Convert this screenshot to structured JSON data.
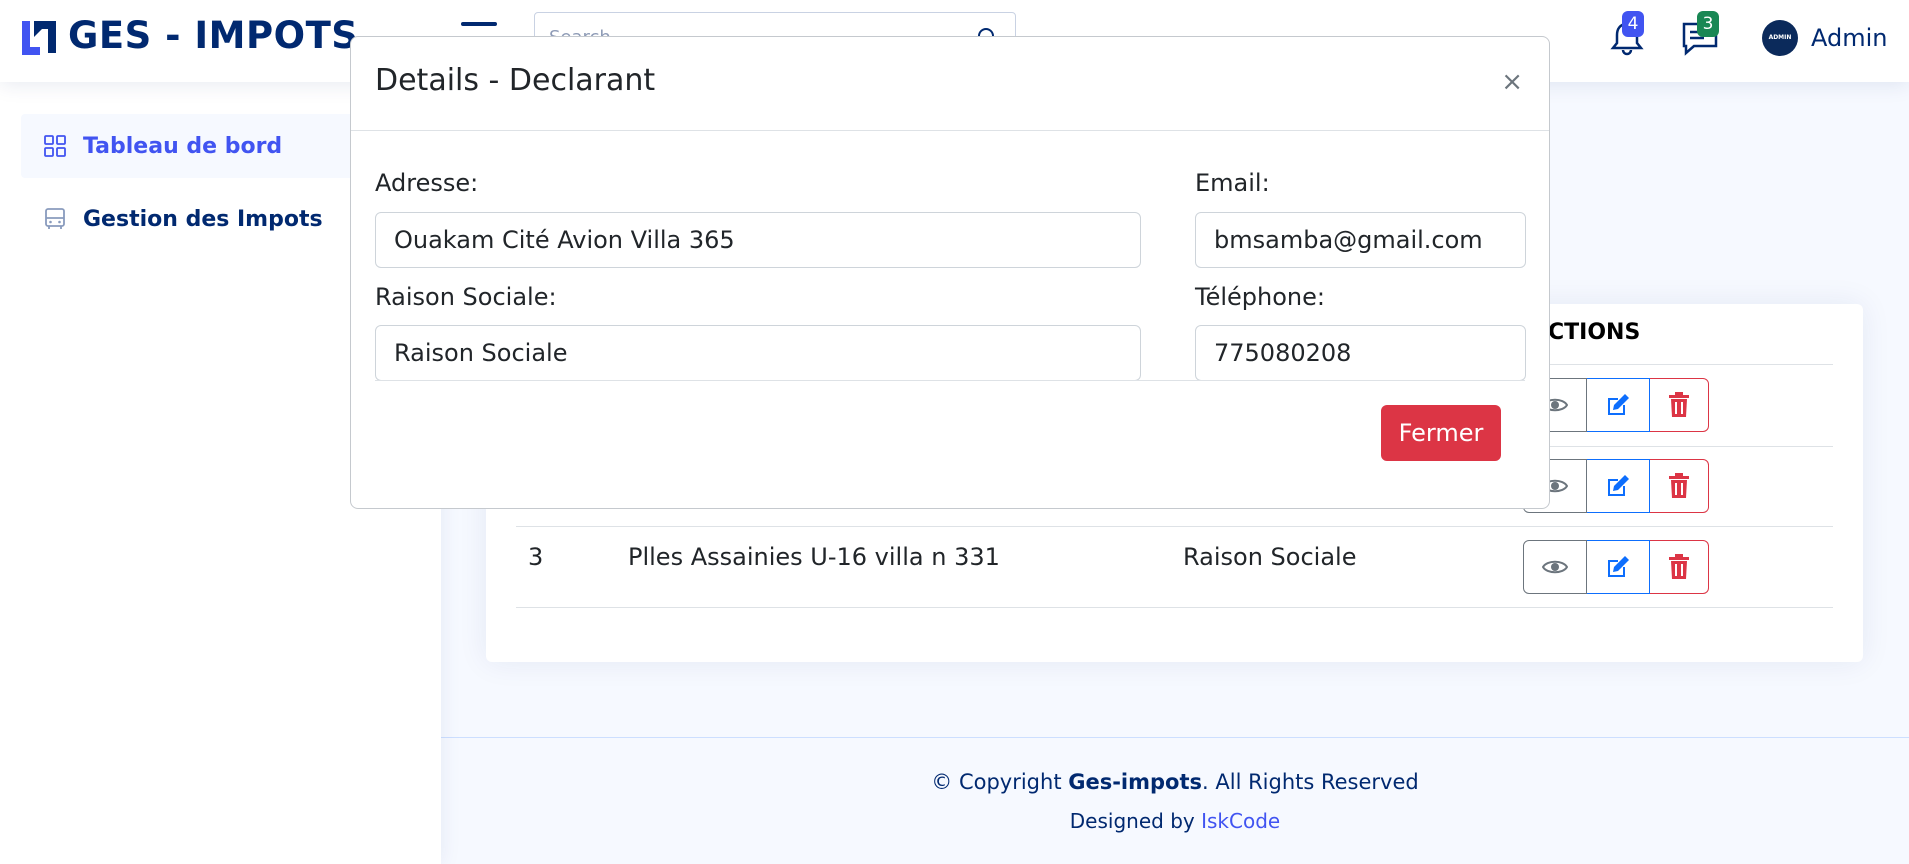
{
  "header": {
    "logo_text": "GES - IMPOTS",
    "search_placeholder": "Search",
    "notifications_count": "4",
    "messages_count": "3",
    "avatar_text": "ADMIN",
    "user_name": "Admin"
  },
  "sidebar": {
    "items": [
      {
        "label": "Tableau de bord",
        "icon": "grid-icon",
        "active": true
      },
      {
        "label": "Gestion des Impots",
        "icon": "bus-icon",
        "active": false
      }
    ]
  },
  "table": {
    "actions_header": "CTIONS",
    "rows": [
      {
        "id": "3",
        "adresse": "Plles Assainies U-16 villa n 331",
        "raison_sociale": "Raison Sociale"
      }
    ]
  },
  "modal": {
    "title": "Details - Declarant",
    "close_glyph": "×",
    "fields": {
      "adresse": {
        "label": "Adresse:",
        "value": "Ouakam Cité Avion Villa 365"
      },
      "email": {
        "label": "Email:",
        "value": "bmsamba@gmail.com"
      },
      "raison_sociale": {
        "label": "Raison Sociale:",
        "value": "Raison Sociale"
      },
      "telephone": {
        "label": "Téléphone:",
        "value": "775080208"
      }
    },
    "close_button": "Fermer"
  },
  "footer": {
    "copyright_prefix": "© Copyright ",
    "brand": "Ges-impots",
    "copyright_suffix": ". All Rights Reserved",
    "designed_by": "Designed by ",
    "designer": "IskCode"
  },
  "colors": {
    "primary": "#4154f1",
    "navy": "#012970",
    "danger": "#dc3545",
    "success": "#198754"
  }
}
